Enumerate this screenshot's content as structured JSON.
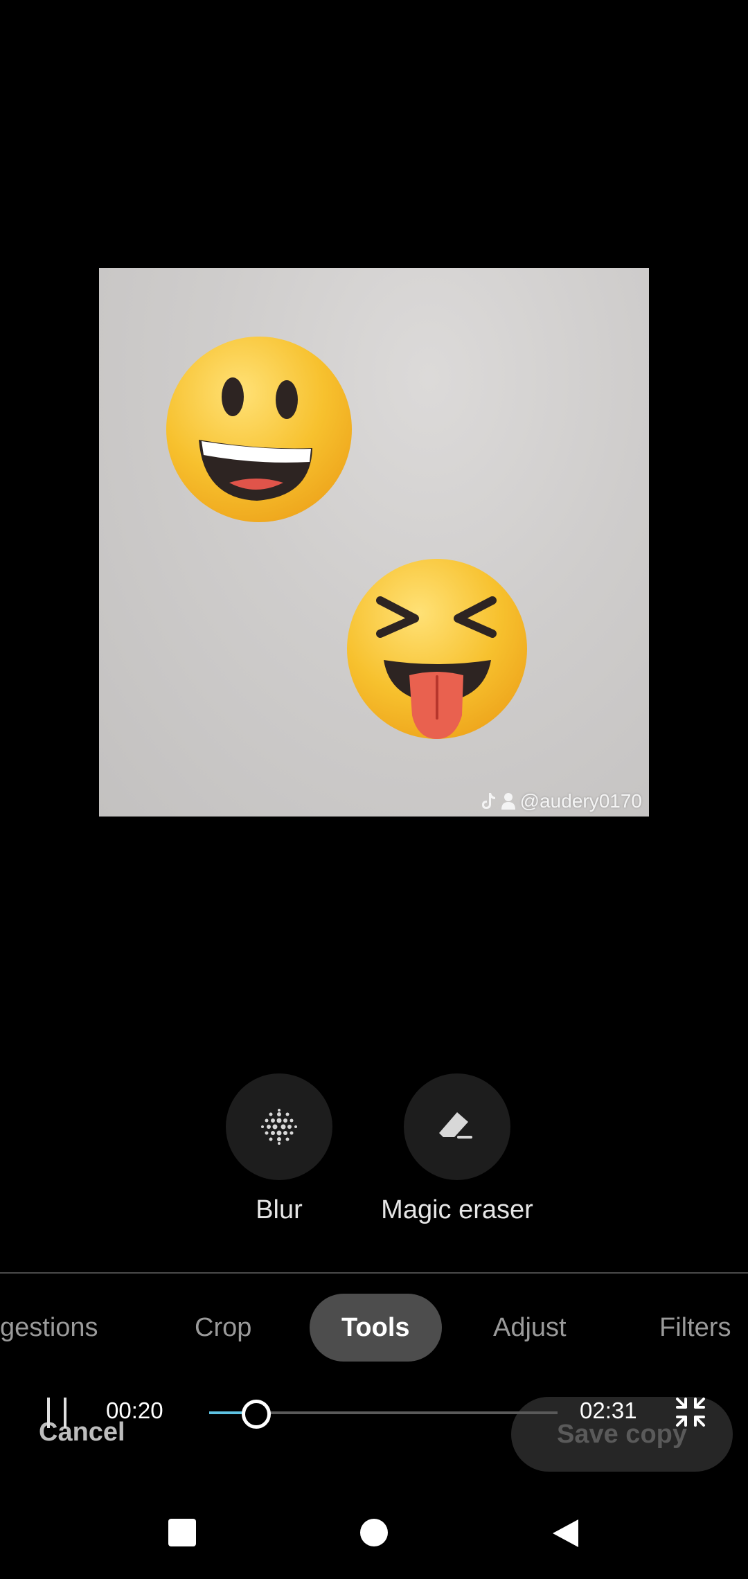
{
  "photo": {
    "watermark": {
      "icons": [
        "tiktok-icon",
        "person-icon"
      ],
      "handle": "@audery0170"
    },
    "stickers": [
      "grinning-face-emoji",
      "squinting-face-with-tongue-emoji"
    ]
  },
  "tools": {
    "items": [
      {
        "label": "Blur",
        "icon": "blur-icon"
      },
      {
        "label": "Magic eraser",
        "icon": "eraser-icon"
      }
    ]
  },
  "tabs": {
    "items": [
      {
        "label": "gestions"
      },
      {
        "label": "Crop"
      },
      {
        "label": "Tools",
        "active": true
      },
      {
        "label": "Adjust"
      },
      {
        "label": "Filters"
      }
    ]
  },
  "actions": {
    "cancel_label": "Cancel",
    "save_label": "Save copy"
  },
  "player": {
    "state_icon": "pause-icon",
    "current_time": "00:20",
    "total_time": "02:31",
    "progress": 0.132,
    "fullscreen_icon": "exit-fullscreen-icon"
  },
  "navbar": {
    "icons": [
      "recents-square-icon",
      "home-circle-icon",
      "back-triangle-icon"
    ]
  },
  "colors": {
    "background": "#000000",
    "accent": "#5ec3e3",
    "active_tab": "#4d4d4d",
    "emoji_yellow": "#f7c12e"
  }
}
